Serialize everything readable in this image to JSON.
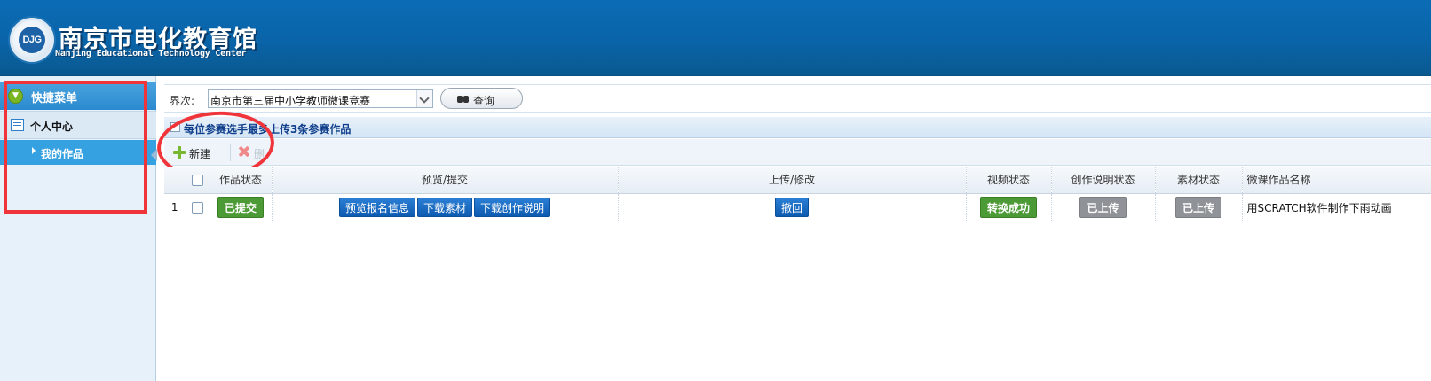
{
  "header": {
    "logo_text": "DJG",
    "title": "南京市电化教育馆",
    "subtitle": "Nanjing Educational Technology Center"
  },
  "sidebar": {
    "section_title": "快捷菜单",
    "group_label": "个人中心",
    "items": [
      {
        "label": "我的作品",
        "selected": true
      }
    ]
  },
  "filter": {
    "label": "界次:",
    "selected_value": "南京市第三届中小学教师微课竞赛",
    "query_button": "查询"
  },
  "notice": {
    "text": "每位参赛选手最多上传3条参赛作品"
  },
  "toolbar": {
    "new_label": "新建",
    "delete_label": "删"
  },
  "table": {
    "columns": [
      "作品状态",
      "预览/提交",
      "上传/修改",
      "视频状态",
      "创作说明状态",
      "素材状态",
      "微课作品名称"
    ],
    "rows": [
      {
        "num": "1",
        "status": "已提交",
        "preview_buttons": [
          "预览报名信息",
          "下载素材",
          "下载创作说明"
        ],
        "upload_button": "撤回",
        "video_status": "转换成功",
        "desc_status": "已上传",
        "material_status": "已上传",
        "name": "用SCRATCH软件制作下雨动画"
      }
    ]
  },
  "colors": {
    "header_blue": "#0a64a8",
    "sidebar_active": "#35a1e1",
    "button_blue": "#0e5ab1",
    "success_green": "#4c9a35",
    "neutral_gray": "#8f9397",
    "annotation_red": "#f0353a"
  }
}
